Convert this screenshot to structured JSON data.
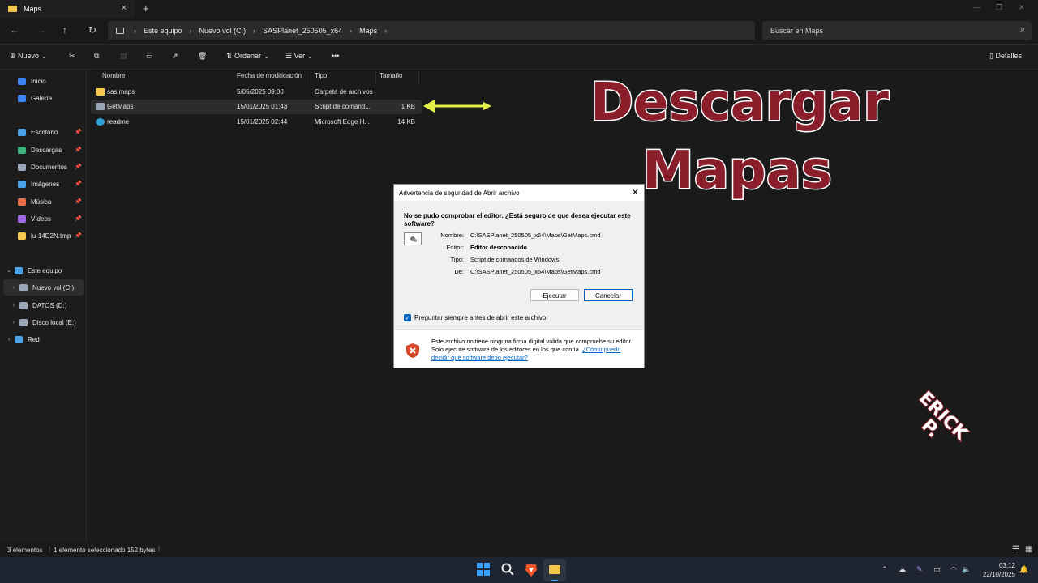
{
  "window": {
    "tab_title": "Maps",
    "close_glyph": "×",
    "newtab_glyph": "+"
  },
  "breadcrumbs": [
    "Este equipo",
    "Nuevo vol (C:)",
    "SASPlanet_250505_x64",
    "Maps"
  ],
  "search": {
    "placeholder": "Buscar en Maps"
  },
  "toolbar": {
    "new_label": "Nuevo",
    "sort_label": "Ordenar",
    "view_label": "Ver",
    "more_label": "•••",
    "details_label": "Detalles"
  },
  "sidebar": {
    "quick": [
      {
        "label": "Inicio",
        "icon": "home-icon",
        "color": "#3b82f6"
      },
      {
        "label": "Galería",
        "icon": "gallery-icon",
        "color": "#3b82f6"
      }
    ],
    "pinned": [
      {
        "label": "Escritorio",
        "icon": "desktop-icon",
        "color": "#4aa3e8"
      },
      {
        "label": "Descargas",
        "icon": "downloads-icon",
        "color": "#3fb37f"
      },
      {
        "label": "Documentos",
        "icon": "documents-icon",
        "color": "#9aa6b8"
      },
      {
        "label": "Imágenes",
        "icon": "pictures-icon",
        "color": "#4aa3e8"
      },
      {
        "label": "Música",
        "icon": "music-icon",
        "color": "#e8704a"
      },
      {
        "label": "Vídeos",
        "icon": "videos-icon",
        "color": "#a06ae8"
      },
      {
        "label": "iu-14D2N.tmp",
        "icon": "folder-icon",
        "color": "#f4c84a"
      }
    ],
    "tree": [
      {
        "label": "Este equipo",
        "icon": "pc-icon",
        "color": "#4aa3e8",
        "expanded": true
      },
      {
        "label": "Nuevo vol (C:)",
        "icon": "drive-icon",
        "color": "#9aa6b8",
        "selected": true
      },
      {
        "label": "DATOS (D:)",
        "icon": "drive-icon",
        "color": "#9aa6b8"
      },
      {
        "label": "Disco local (E:)",
        "icon": "drive-icon",
        "color": "#9aa6b8"
      },
      {
        "label": "Red",
        "icon": "network-icon",
        "color": "#4aa3e8"
      }
    ]
  },
  "columns": [
    "Nombre",
    "Fecha de modificación",
    "Tipo",
    "Tamaño"
  ],
  "files": [
    {
      "name": "sas.maps",
      "date": "5/05/2025 09:00",
      "type": "Carpeta de archivos",
      "size": "",
      "icon": "folder-icon",
      "color": "#f4c84a"
    },
    {
      "name": "GetMaps",
      "date": "15/01/2025 01:43",
      "type": "Script de comand...",
      "size": "1 KB",
      "icon": "script-icon",
      "color": "#9aa6b8",
      "selected": true
    },
    {
      "name": "readme",
      "date": "15/01/2025 02:44",
      "type": "Microsoft Edge H...",
      "size": "14 KB",
      "icon": "edge-icon",
      "color": "#2fa1d6"
    }
  ],
  "overlay": {
    "line1": "Descargar",
    "line2": "Mapas"
  },
  "dialog": {
    "title": "Advertencia de seguridad de Abrir archivo",
    "question": "No se pudo comprobar el editor. ¿Está seguro de que desea ejecutar este software?",
    "fields": [
      {
        "label": "Nombre:",
        "value": "C:\\SASPlanet_250505_x64\\Maps\\GetMaps.cmd",
        "bold": false
      },
      {
        "label": "Editor:",
        "value": "Editor desconocido",
        "bold": true
      },
      {
        "label": "Tipo:",
        "value": "Script de comandos de Windows",
        "bold": false
      },
      {
        "label": "De:",
        "value": "C:\\SASPlanet_250505_x64\\Maps\\GetMaps.cmd",
        "bold": false
      }
    ],
    "run_label": "Ejecutar",
    "cancel_label": "Cancelar",
    "checkbox_label": "Preguntar siempre antes de abrir este archivo",
    "footer_text": "Este archivo no tiene ninguna firma digital válida que compruebe su editor. Solo ejecute software de los editores en los que confía.",
    "footer_link": "¿Cómo puedo decidir qué software debo ejecutar?"
  },
  "status": {
    "count": "3 elementos",
    "selection": "1 elemento seleccionado  152 bytes"
  },
  "taskbar": {
    "time": "03:12",
    "date": "22/10/2025"
  },
  "watermark": {
    "line1": "ERICK",
    "line2": "P."
  }
}
